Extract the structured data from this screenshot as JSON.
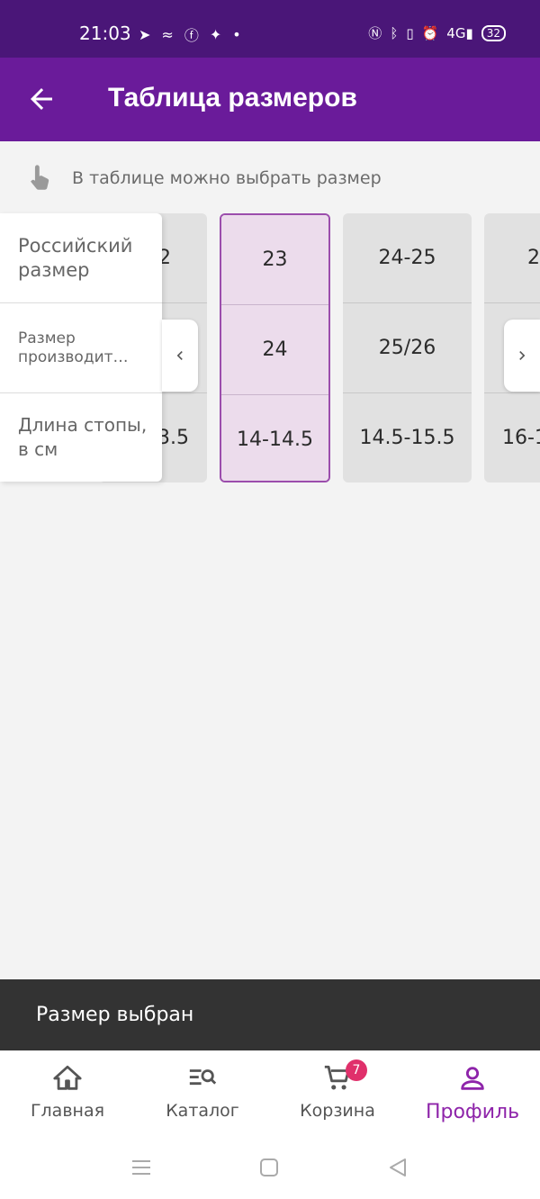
{
  "status_bar": {
    "time": "21:03",
    "battery": "32",
    "network": "4G"
  },
  "app_bar": {
    "title": "Таблица размеров"
  },
  "hint": {
    "text": "В таблице можно выбрать размер"
  },
  "row_labels": [
    "Российский размер",
    "Размер производит…",
    "Длина стопы, в см"
  ],
  "columns": [
    {
      "ru": "2",
      "maker": "",
      "foot": "3.5"
    },
    {
      "ru": "23",
      "maker": "24",
      "foot": "14-14.5",
      "selected": true
    },
    {
      "ru": "24-25",
      "maker": "25/26",
      "foot": "14.5-15.5"
    },
    {
      "ru": "2",
      "maker": "",
      "foot": "16-1"
    }
  ],
  "snackbar": {
    "text": "Размер выбран"
  },
  "bottom_nav": {
    "items": [
      {
        "label": "Главная",
        "icon": "home-icon"
      },
      {
        "label": "Каталог",
        "icon": "catalog-search-icon"
      },
      {
        "label": "Корзина",
        "icon": "cart-icon",
        "badge": "7"
      },
      {
        "label": "Профиль",
        "icon": "profile-icon",
        "active": true
      }
    ]
  },
  "colors": {
    "status_bar": "#4a1678",
    "app_bar": "#6a1b9a",
    "accent": "#8e24aa",
    "badge": "#e0306b",
    "selected_bg": "#ecdcec"
  }
}
